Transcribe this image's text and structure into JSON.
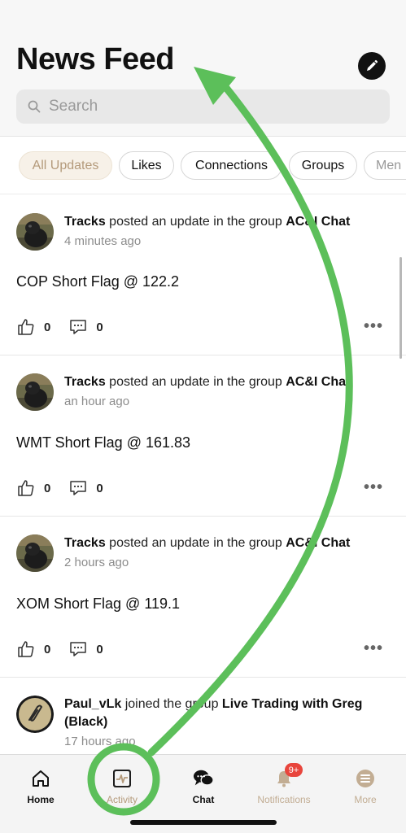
{
  "header": {
    "title": "News Feed",
    "compose_icon": "pencil-icon",
    "search_placeholder": "Search"
  },
  "filters": [
    {
      "label": "All Updates",
      "active": true
    },
    {
      "label": "Likes",
      "active": false
    },
    {
      "label": "Connections",
      "active": false
    },
    {
      "label": "Groups",
      "active": false
    },
    {
      "label": "Men",
      "active": false
    }
  ],
  "posts": [
    {
      "author": "Tracks",
      "action": " posted an update in the group ",
      "target": "AC&I Chat",
      "time": "4 minutes ago",
      "content": "COP Short Flag @ 122.2",
      "likes": "0",
      "comments": "0"
    },
    {
      "author": "Tracks",
      "action": " posted an update in the group ",
      "target": "AC&I Chat",
      "time": "an hour ago",
      "content": "WMT Short Flag @ 161.83",
      "likes": "0",
      "comments": "0"
    },
    {
      "author": "Tracks",
      "action": " posted an update in the group ",
      "target": "AC&I Chat",
      "time": "2 hours ago",
      "content": "XOM Short Flag @ 119.1",
      "likes": "0",
      "comments": "0"
    },
    {
      "author": "Paul_vLk",
      "action": " joined the group ",
      "target": "Live Trading with Greg (Black)",
      "time": "17 hours ago"
    }
  ],
  "tabbar": {
    "items": [
      {
        "label": "Home",
        "icon": "home-icon"
      },
      {
        "label": "Activity",
        "icon": "activity-icon",
        "active": true
      },
      {
        "label": "Chat",
        "icon": "chat-icon"
      },
      {
        "label": "Notifications",
        "icon": "bell-icon",
        "badge": "9+"
      },
      {
        "label": "More",
        "icon": "more-icon"
      }
    ]
  },
  "colors": {
    "accent": "#b49a7b",
    "annotation_green": "#5cbf5a",
    "badge_red": "#e8453c"
  }
}
